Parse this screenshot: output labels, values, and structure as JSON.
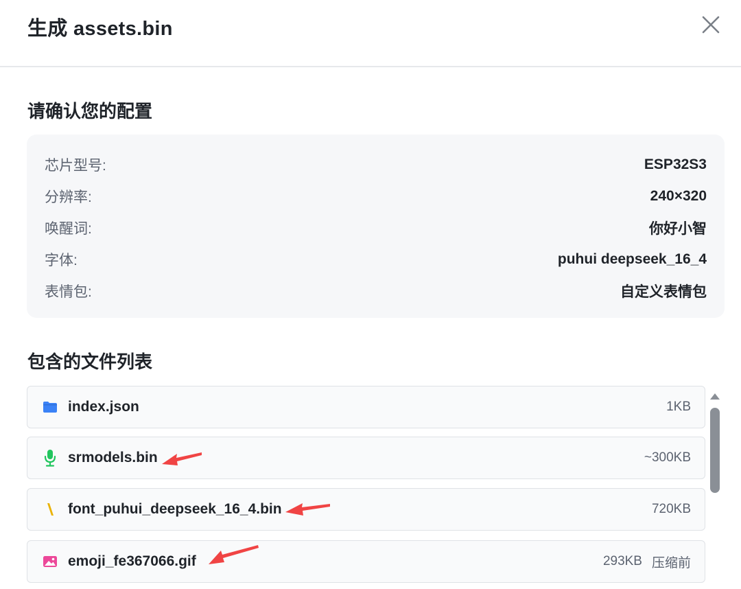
{
  "dialog": {
    "title": "生成 assets.bin"
  },
  "confirm": {
    "heading": "请确认您的配置",
    "rows": [
      {
        "label": "芯片型号:",
        "value": "ESP32S3"
      },
      {
        "label": "分辨率:",
        "value": "240×320"
      },
      {
        "label": "唤醒词:",
        "value": "你好小智"
      },
      {
        "label": "字体:",
        "value": "puhui deepseek_16_4"
      },
      {
        "label": "表情包:",
        "value": "自定义表情包"
      }
    ]
  },
  "files": {
    "heading": "包含的文件列表",
    "items": [
      {
        "name": "index.json",
        "size": "1KB",
        "icon": "folder-icon",
        "color": "#3b82f6"
      },
      {
        "name": "srmodels.bin",
        "size": "~300KB",
        "icon": "microphone-icon",
        "color": "#22c55e"
      },
      {
        "name": "font_puhui_deepseek_16_4.bin",
        "size": "720KB",
        "icon": "font-icon",
        "color": "#eab308"
      },
      {
        "name": "emoji_fe367066.gif",
        "size": "293KB",
        "note": "压缩前",
        "icon": "image-icon",
        "color": "#ec4899"
      }
    ]
  },
  "colors": {
    "annotation_arrow": "#f04444"
  }
}
